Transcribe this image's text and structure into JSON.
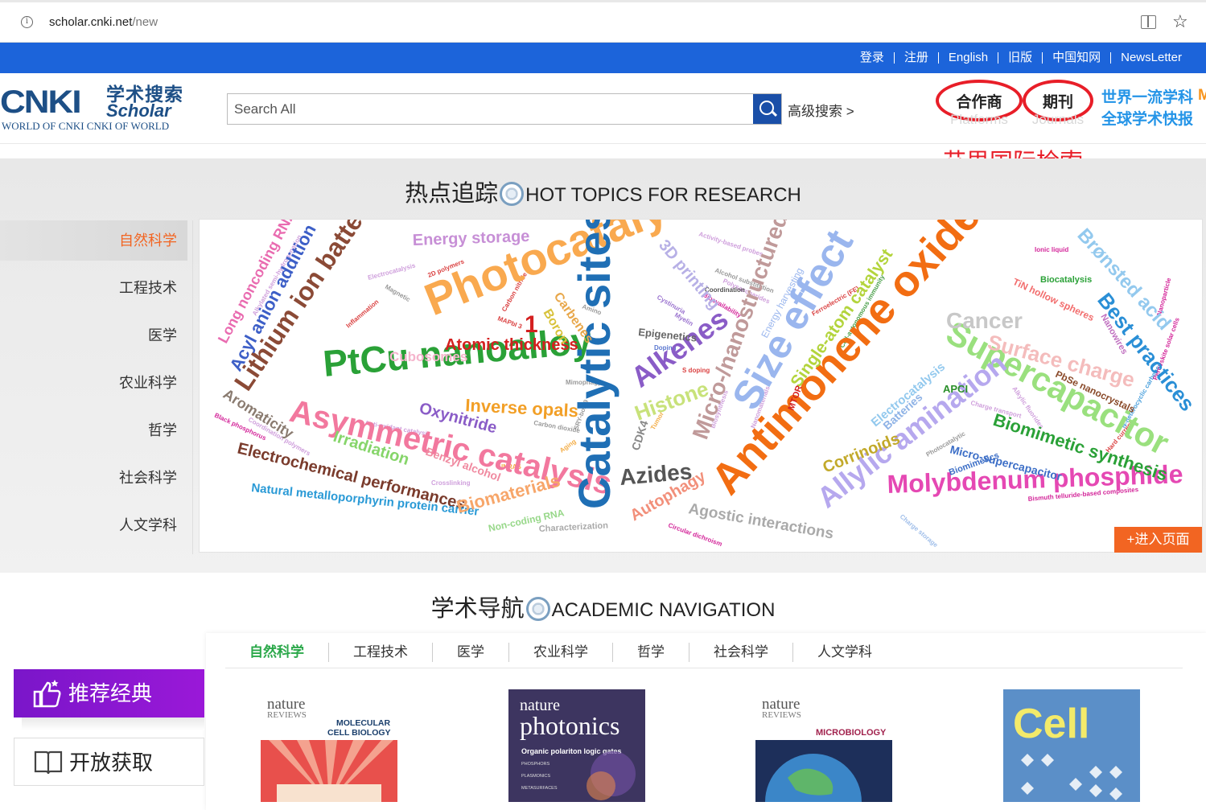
{
  "browser": {
    "url_host": "scholar.cnki.net",
    "url_path": "/new"
  },
  "topnav": {
    "items": [
      "登录",
      "注册",
      "English",
      "旧版",
      "中国知网",
      "NewsLetter"
    ]
  },
  "header": {
    "logo_main": "CNKI",
    "logo_cn": "学术搜索",
    "logo_scholar": "Scholar",
    "logo_tagline": "WORLD OF CNKI CNKI OF WORLD",
    "search_placeholder": "Search All",
    "advanced_search": "高级搜索 >",
    "partner_label": "合作商",
    "partner_sub": "Platforms",
    "journal_label": "期刊",
    "journal_sub": "Journals",
    "world_line1": "世界一流学科",
    "world_line2": "全球学术快报",
    "world_cut": "M",
    "annotation": "艾思国际检索",
    "accent_color": "#1c64da",
    "annotation_color": "#e81e28"
  },
  "hot_topics": {
    "title_cn": "热点追踪",
    "title_en": "HOT TOPICS FOR RESEARCH",
    "categories": [
      "自然科学",
      "工程技术",
      "医学",
      "农业科学",
      "哲学",
      "社会科学",
      "人文学科"
    ],
    "active_category": "自然科学",
    "enter_button": "+进入页面",
    "words": [
      {
        "text": "Photocatalysis",
        "color": "#f9a94f"
      },
      {
        "text": "PtCu nanoalloy",
        "color": "#2aa137"
      },
      {
        "text": "Asymmetric catalysis",
        "color": "#f2789e"
      },
      {
        "text": "Catalytic sites",
        "color": "#1f6fb5"
      },
      {
        "text": "Antimonene oxides",
        "color": "#f26d12"
      },
      {
        "text": "Size effect",
        "color": "#9ab6ee"
      },
      {
        "text": "Supercapacitor",
        "color": "#9ae07e"
      },
      {
        "text": "Molybdenum phosphide",
        "color": "#e548b3"
      },
      {
        "text": "Allylic amination",
        "color": "#b6a8ee"
      },
      {
        "text": "Lithium ion battery",
        "color": "#8b4a36"
      },
      {
        "text": "Micro-/nanostructured",
        "color": "#c09a9a"
      },
      {
        "text": "Alkenes",
        "color": "#8a5cc7"
      },
      {
        "text": "Atomic thickness",
        "color": "#d42020"
      },
      {
        "text": "Energy storage",
        "color": "#c78fd6"
      },
      {
        "text": "Inverse opals",
        "color": "#f29f26"
      },
      {
        "text": "Azides",
        "color": "#555555"
      },
      {
        "text": "Biomimetic synthesis",
        "color": "#2aa137"
      },
      {
        "text": "Electrochemical performances",
        "color": "#7a3b2c"
      },
      {
        "text": "Natural metalloporphyrin protein carrier",
        "color": "#2a9ad6"
      },
      {
        "text": "Biomaterials",
        "color": "#f7a66a"
      },
      {
        "text": "Histone",
        "color": "#c8e27a"
      },
      {
        "text": "Autophagy",
        "color": "#f28f7a"
      },
      {
        "text": "Agostic interactions",
        "color": "#aaaaaa"
      },
      {
        "text": "Single-atom catalyst",
        "color": "#b3d43c"
      },
      {
        "text": "Best practices",
        "color": "#2a8fd6"
      },
      {
        "text": "Brønsted acid",
        "color": "#93c9ee"
      },
      {
        "text": "Cancer",
        "color": "#c8c8c8"
      },
      {
        "text": "Surface charge",
        "color": "#f4bcbc"
      },
      {
        "text": "Irradiation",
        "color": "#86d56a"
      },
      {
        "text": "Oxynitride",
        "color": "#8a5cc7"
      },
      {
        "text": "Cubosomes",
        "color": "#f5b4cc"
      },
      {
        "text": "Aromaticity",
        "color": "#8a7b70"
      },
      {
        "text": "Acyl anion addition",
        "color": "#3d5fc7"
      },
      {
        "text": "Long noncoding RNAs",
        "color": "#e96bb0"
      },
      {
        "text": "Corrinoids",
        "color": "#c2a92a"
      },
      {
        "text": "Micro-supercapacitor",
        "color": "#3d6fc7"
      },
      {
        "text": "Benzyl alcohol",
        "color": "#f08aa0"
      },
      {
        "text": "3D printing",
        "color": "#b7b0e6"
      },
      {
        "text": "Carbenes",
        "color": "#e8a74a"
      },
      {
        "text": "Boron",
        "color": "#d8c23a"
      },
      {
        "text": "Epigenetics",
        "color": "#666666"
      },
      {
        "text": "Electrocatalysis",
        "color": "#93c9ee"
      },
      {
        "text": "Batteries",
        "color": "#8fb3e6"
      },
      {
        "text": "Non-coding RNA",
        "color": "#98d88a"
      },
      {
        "text": "Characterization",
        "color": "#aaaaaa"
      },
      {
        "text": "CDK4",
        "color": "#888888"
      },
      {
        "text": "1",
        "color": "#d42020"
      },
      {
        "text": "MTOR",
        "color": "#d42020"
      },
      {
        "text": "APCI",
        "color": "#2a8f2a"
      },
      {
        "text": "PbSe nanocrystals",
        "color": "#8a4a2a"
      },
      {
        "text": "TiN hollow spheres",
        "color": "#f26d6d"
      },
      {
        "text": "Energy harvesting",
        "color": "#9ab6ee"
      },
      {
        "text": "Biocatalysis",
        "color": "#2aa137"
      },
      {
        "text": "Nanowires",
        "color": "#c070c0"
      },
      {
        "text": "Biomimetics",
        "color": "#3d6fc7"
      }
    ]
  },
  "academic_nav": {
    "title_cn": "学术导航",
    "title_en": "ACADEMIC NAVIGATION",
    "tabs": [
      "自然科学",
      "工程技术",
      "医学",
      "农业科学",
      "哲学",
      "社会科学",
      "人文学科"
    ],
    "active_tab": "自然科学",
    "side_buttons": [
      "推荐经典",
      "开放获取"
    ],
    "covers": [
      {
        "brand": "nature",
        "sub": "REVIEWS",
        "title": "MOLECULAR\nCELL BIOLOGY"
      },
      {
        "brand": "nature",
        "sub": "photonics",
        "title": "Organic polariton logic gates"
      },
      {
        "brand": "nature",
        "sub": "REVIEWS",
        "title": "MICROBIOLOGY"
      },
      {
        "brand": "Cell",
        "sub": "",
        "title": ""
      }
    ]
  }
}
